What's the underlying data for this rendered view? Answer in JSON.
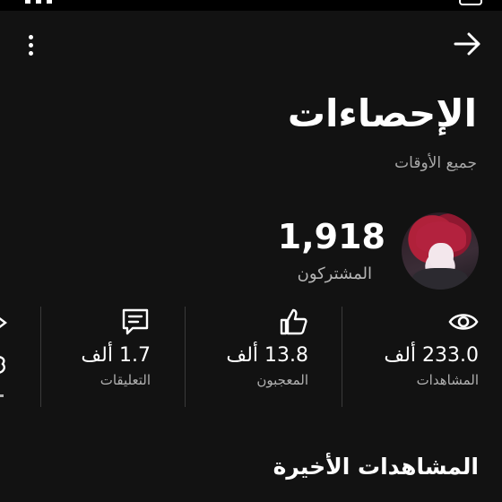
{
  "header": {
    "title": "الإحصاءات",
    "subtitle": "جميع الأوقات"
  },
  "channel": {
    "subscribers_count": "1,918",
    "subscribers_label": "المشتركون"
  },
  "stats": [
    {
      "icon": "eye-icon",
      "value": "233.0 ألف",
      "label": "المشاهدات"
    },
    {
      "icon": "thumbs-up-icon",
      "value": "13.8 ألف",
      "label": "المعجبون"
    },
    {
      "icon": "comment-icon",
      "value": "1.7 ألف",
      "label": "التعليقات"
    }
  ],
  "section": {
    "recent_views_title": "المشاهدات الأخيرة"
  },
  "colors": {
    "background": "#121212",
    "text": "#ffffff",
    "secondary_text": "#b0b0b0",
    "divider": "#3a3a3a"
  }
}
